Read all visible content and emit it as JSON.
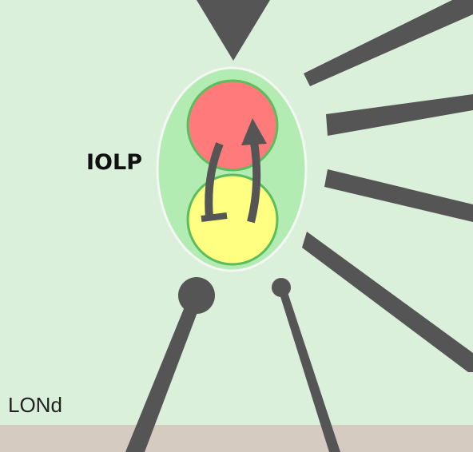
{
  "labels": {
    "region": "IOLP",
    "layer": "LONd"
  },
  "colors": {
    "background": "#daf0da",
    "floor": "#d6cbc0",
    "outer_region_fill": "#b3ecb3",
    "outer_region_stroke": "#f4f7f4",
    "cell_red": "#ff7b7b",
    "cell_yellow": "#ffff82",
    "cell_stroke": "#5cbd5c",
    "inputs_and_arrows": "#555555"
  },
  "icons": {
    "activation": "arrow-icon",
    "inhibition": "tbar-icon",
    "input_top": "triangle-input-icon",
    "synapse_large": "large-bouton-icon",
    "synapse_small": "small-bouton-icon"
  }
}
